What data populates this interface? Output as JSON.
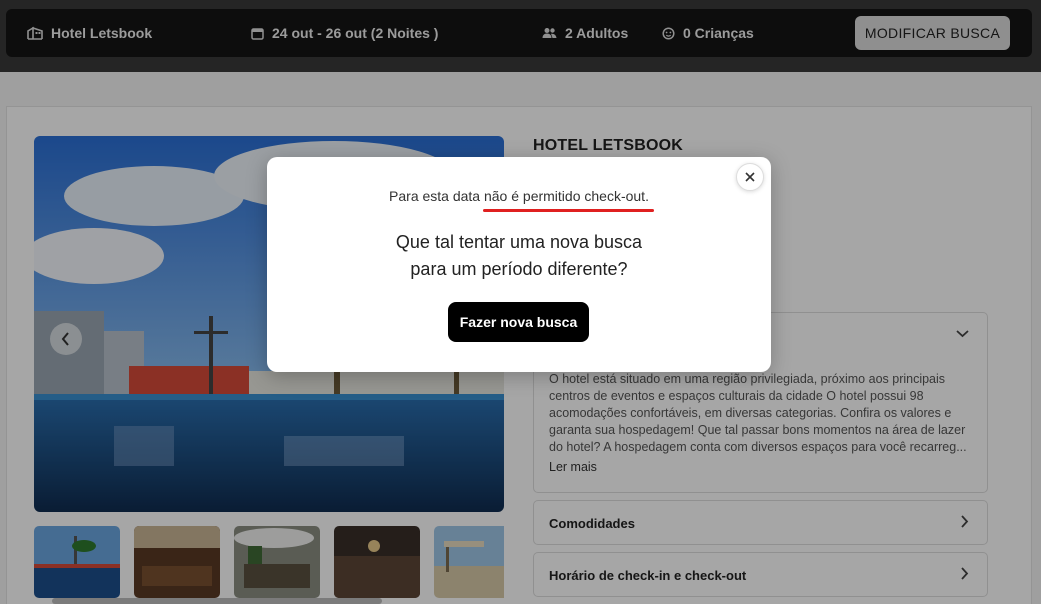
{
  "header": {
    "hotel_name": "Hotel Letsbook",
    "dates": "24 out - 26 out (2 Noites )",
    "adults": "2 Adultos",
    "children": "0 Crianças",
    "modify_button": "MODIFICAR BUSCA"
  },
  "hotel": {
    "title": "HOTEL LETSBOOK",
    "description": "O hotel está situado em uma região privilegiada, próximo aos principais centros de eventos e espaços culturais da cidade O hotel possui 98 acomodações confortáveis, em diversas categorias. Confira os valores e garanta sua hospedagem! Que tal passar bons momentos na área de lazer do hotel? A hospedagem conta com diversos espaços para você recarreg...",
    "read_more": "Ler mais"
  },
  "panels": {
    "amenities": "Comodidades",
    "checkin": "Horário de check-in e check-out"
  },
  "modal": {
    "notice": "Para esta data não é permitido check-out.",
    "question_line1": "Que tal tentar uma nova busca",
    "question_line2": "para um período diferente?",
    "button": "Fazer nova busca"
  },
  "colors": {
    "accent_underline": "#e02020",
    "topbar": "#141414",
    "primary_button": "#000000"
  }
}
